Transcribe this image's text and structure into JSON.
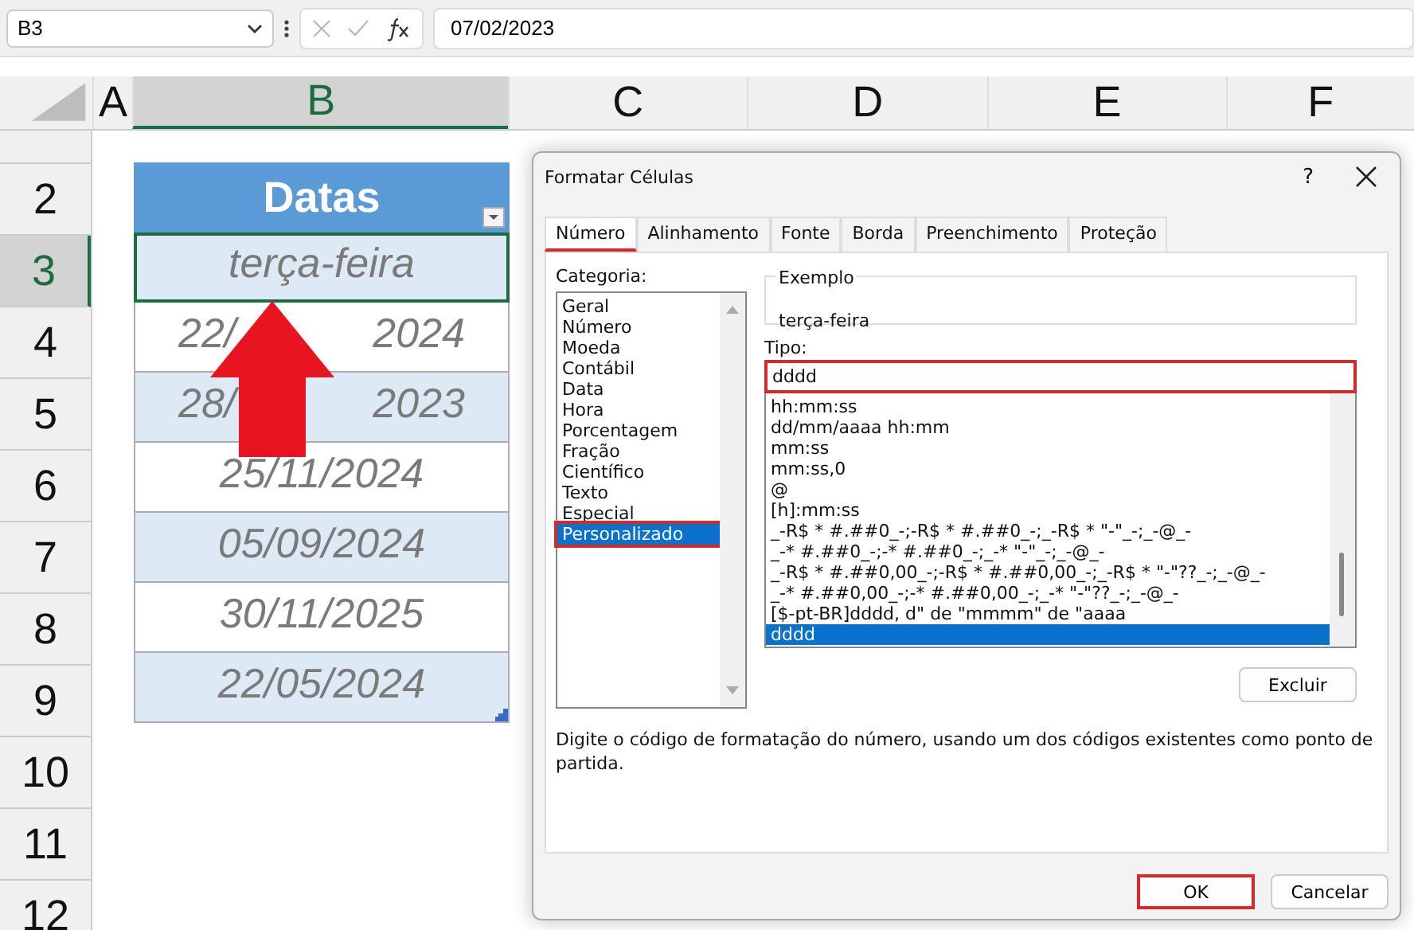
{
  "formula_bar": {
    "name_box": "B3",
    "value": "07/02/2023"
  },
  "columns": [
    {
      "label": "A",
      "selected": false
    },
    {
      "label": "B",
      "selected": true
    },
    {
      "label": "C",
      "selected": false
    },
    {
      "label": "D",
      "selected": false
    },
    {
      "label": "E",
      "selected": false
    },
    {
      "label": "F",
      "selected": false
    }
  ],
  "rows": [
    {
      "label": "2",
      "selected": false
    },
    {
      "label": "3",
      "selected": true
    },
    {
      "label": "4",
      "selected": false
    },
    {
      "label": "5",
      "selected": false
    },
    {
      "label": "6",
      "selected": false
    },
    {
      "label": "7",
      "selected": false
    },
    {
      "label": "8",
      "selected": false
    },
    {
      "label": "9",
      "selected": false
    },
    {
      "label": "10",
      "selected": false
    },
    {
      "label": "11",
      "selected": false
    },
    {
      "label": "12",
      "selected": false
    }
  ],
  "table": {
    "header": "Datas",
    "cells": [
      {
        "parts": [
          "terça-feira"
        ],
        "selected": true
      },
      {
        "parts": [
          "22/",
          "2024"
        ],
        "selected": false
      },
      {
        "parts": [
          "28/",
          "2023"
        ],
        "selected": false
      },
      {
        "parts": [
          "25/11/2024"
        ],
        "selected": false
      },
      {
        "parts": [
          "05/09/2024"
        ],
        "selected": false
      },
      {
        "parts": [
          "30/11/2025"
        ],
        "selected": false
      },
      {
        "parts": [
          "22/05/2024"
        ],
        "selected": false
      }
    ]
  },
  "dialog": {
    "title": "Formatar Células",
    "help": "?",
    "tabs": [
      {
        "label": "Número",
        "selected": true
      },
      {
        "label": "Alinhamento",
        "selected": false
      },
      {
        "label": "Fonte",
        "selected": false
      },
      {
        "label": "Borda",
        "selected": false
      },
      {
        "label": "Preenchimento",
        "selected": false
      },
      {
        "label": "Proteção",
        "selected": false
      }
    ],
    "category_label": "Categoria:",
    "categories": [
      {
        "label": "Geral",
        "selected": false
      },
      {
        "label": "Número",
        "selected": false
      },
      {
        "label": "Moeda",
        "selected": false
      },
      {
        "label": "Contábil",
        "selected": false
      },
      {
        "label": "Data",
        "selected": false
      },
      {
        "label": "Hora",
        "selected": false
      },
      {
        "label": "Porcentagem",
        "selected": false
      },
      {
        "label": "Fração",
        "selected": false
      },
      {
        "label": "Científico",
        "selected": false
      },
      {
        "label": "Texto",
        "selected": false
      },
      {
        "label": "Especial",
        "selected": false
      },
      {
        "label": "Personalizado",
        "selected": true
      }
    ],
    "example_label": "Exemplo",
    "example": "terça-feira",
    "type_label": "Tipo:",
    "type_value": "dddd",
    "formats": [
      {
        "label": "hh:mm:ss",
        "selected": false
      },
      {
        "label": "dd/mm/aaaa hh:mm",
        "selected": false
      },
      {
        "label": "mm:ss",
        "selected": false
      },
      {
        "label": "mm:ss,0",
        "selected": false
      },
      {
        "label": "@",
        "selected": false
      },
      {
        "label": "[h]:mm:ss",
        "selected": false
      },
      {
        "label": "_-R$ * #.##0_-;-R$ * #.##0_-;_-R$ * \"-\"_-;_-@_-",
        "selected": false
      },
      {
        "label": "_-* #.##0_-;-* #.##0_-;_-* \"-\"_-;_-@_-",
        "selected": false
      },
      {
        "label": "_-R$ * #.##0,00_-;-R$ * #.##0,00_-;_-R$ * \"-\"??_-;_-@_-",
        "selected": false
      },
      {
        "label": "_-* #.##0,00_-;-* #.##0,00_-;_-* \"-\"??_-;_-@_-",
        "selected": false
      },
      {
        "label": "[$-pt-BR]dddd, d\" de \"mmmm\" de \"aaaa",
        "selected": false
      },
      {
        "label": "dddd",
        "selected": true
      }
    ],
    "delete_button": "Excluir",
    "description": "Digite o código de formatação do número, usando um dos códigos existentes como ponto de partida.",
    "ok_button": "OK",
    "cancel_button": "Cancelar"
  }
}
